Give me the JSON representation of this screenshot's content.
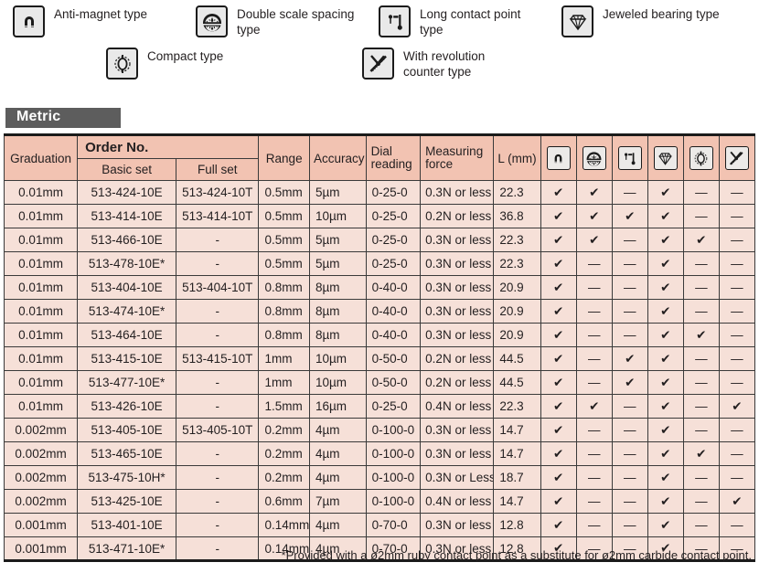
{
  "legend": {
    "row1": [
      {
        "icon": "anti-magnet-icon",
        "label": "Anti-magnet type"
      },
      {
        "icon": "double-scale-spacing-icon",
        "label": "Double scale spacing type"
      },
      {
        "icon": "long-contact-point-icon",
        "label": "Long contact point type"
      },
      {
        "icon": "jeweled-bearing-icon",
        "label": "Jeweled bearing type"
      }
    ],
    "row2": [
      {
        "icon": "compact-icon",
        "label": "Compact type"
      },
      {
        "icon": "revolution-counter-icon",
        "label": "With revolution counter type"
      }
    ]
  },
  "banner": {
    "label": "Metric"
  },
  "table": {
    "headers": {
      "graduation": "Graduation",
      "order_no": "Order No.",
      "basic_set": "Basic set",
      "full_set": "Full set",
      "range": "Range",
      "accuracy": "Accuracy",
      "dial_reading": "Dial reading",
      "measuring_force": "Measuring force",
      "length": "L (mm)",
      "icon_cols": [
        "anti-magnet-icon",
        "double-scale-spacing-icon",
        "long-contact-point-icon",
        "jeweled-bearing-icon",
        "compact-icon",
        "revolution-counter-icon"
      ]
    },
    "rows": [
      {
        "graduation": "0.01mm",
        "basic_set": "513-424-10E",
        "full_set": "513-424-10T",
        "range": "0.5mm",
        "accuracy": "5µm",
        "dial_reading": "0-25-0",
        "measuring_force": "0.3N or less",
        "length": "22.3",
        "marks": [
          "✔",
          "✔",
          "—",
          "✔",
          "—",
          "—"
        ]
      },
      {
        "graduation": "0.01mm",
        "basic_set": "513-414-10E",
        "full_set": "513-414-10T",
        "range": "0.5mm",
        "accuracy": "10µm",
        "dial_reading": "0-25-0",
        "measuring_force": "0.2N or less",
        "length": "36.8",
        "marks": [
          "✔",
          "✔",
          "✔",
          "✔",
          "—",
          "—"
        ]
      },
      {
        "graduation": "0.01mm",
        "basic_set": "513-466-10E",
        "full_set": "-",
        "range": "0.5mm",
        "accuracy": "5µm",
        "dial_reading": "0-25-0",
        "measuring_force": "0.3N or less",
        "length": "22.3",
        "marks": [
          "✔",
          "✔",
          "—",
          "✔",
          "✔",
          "—"
        ]
      },
      {
        "graduation": "0.01mm",
        "basic_set": "513-478-10E*",
        "full_set": "-",
        "range": "0.5mm",
        "accuracy": "5µm",
        "dial_reading": "0-25-0",
        "measuring_force": "0.3N or less",
        "length": "22.3",
        "marks": [
          "✔",
          "—",
          "—",
          "✔",
          "—",
          "—"
        ]
      },
      {
        "graduation": "0.01mm",
        "basic_set": "513-404-10E",
        "full_set": "513-404-10T",
        "range": "0.8mm",
        "accuracy": "8µm",
        "dial_reading": "0-40-0",
        "measuring_force": "0.3N or less",
        "length": "20.9",
        "marks": [
          "✔",
          "—",
          "—",
          "✔",
          "—",
          "—"
        ]
      },
      {
        "graduation": "0.01mm",
        "basic_set": "513-474-10E*",
        "full_set": "-",
        "range": "0.8mm",
        "accuracy": "8µm",
        "dial_reading": "0-40-0",
        "measuring_force": "0.3N or less",
        "length": "20.9",
        "marks": [
          "✔",
          "—",
          "—",
          "✔",
          "—",
          "—"
        ]
      },
      {
        "graduation": "0.01mm",
        "basic_set": "513-464-10E",
        "full_set": "-",
        "range": "0.8mm",
        "accuracy": "8µm",
        "dial_reading": "0-40-0",
        "measuring_force": "0.3N or less",
        "length": "20.9",
        "marks": [
          "✔",
          "—",
          "—",
          "✔",
          "✔",
          "—"
        ]
      },
      {
        "graduation": "0.01mm",
        "basic_set": "513-415-10E",
        "full_set": "513-415-10T",
        "range": "1mm",
        "accuracy": "10µm",
        "dial_reading": "0-50-0",
        "measuring_force": "0.2N or less",
        "length": "44.5",
        "marks": [
          "✔",
          "—",
          "✔",
          "✔",
          "—",
          "—"
        ]
      },
      {
        "graduation": "0.01mm",
        "basic_set": "513-477-10E*",
        "full_set": "-",
        "range": "1mm",
        "accuracy": "10µm",
        "dial_reading": "0-50-0",
        "measuring_force": "0.2N or less",
        "length": "44.5",
        "marks": [
          "✔",
          "—",
          "✔",
          "✔",
          "—",
          "—"
        ]
      },
      {
        "graduation": "0.01mm",
        "basic_set": "513-426-10E",
        "full_set": "-",
        "range": "1.5mm",
        "accuracy": "16µm",
        "dial_reading": "0-25-0",
        "measuring_force": "0.4N or less",
        "length": "22.3",
        "marks": [
          "✔",
          "✔",
          "—",
          "✔",
          "—",
          "✔"
        ]
      },
      {
        "graduation": "0.002mm",
        "basic_set": "513-405-10E",
        "full_set": "513-405-10T",
        "range": "0.2mm",
        "accuracy": "4µm",
        "dial_reading": "0-100-0",
        "measuring_force": "0.3N or less",
        "length": "14.7",
        "marks": [
          "✔",
          "—",
          "—",
          "✔",
          "—",
          "—"
        ]
      },
      {
        "graduation": "0.002mm",
        "basic_set": "513-465-10E",
        "full_set": "-",
        "range": "0.2mm",
        "accuracy": "4µm",
        "dial_reading": "0-100-0",
        "measuring_force": "0.3N or less",
        "length": "14.7",
        "marks": [
          "✔",
          "—",
          "—",
          "✔",
          "✔",
          "—"
        ]
      },
      {
        "graduation": "0.002mm",
        "basic_set": "513-475-10H*",
        "full_set": "-",
        "range": "0.2mm",
        "accuracy": "4µm",
        "dial_reading": "0-100-0",
        "measuring_force": "0.3N or Less",
        "length": "18.7",
        "marks": [
          "✔",
          "—",
          "—",
          "✔",
          "—",
          "—"
        ]
      },
      {
        "graduation": "0.002mm",
        "basic_set": "513-425-10E",
        "full_set": "-",
        "range": "0.6mm",
        "accuracy": "7µm",
        "dial_reading": "0-100-0",
        "measuring_force": "0.4N or less",
        "length": "14.7",
        "marks": [
          "✔",
          "—",
          "—",
          "✔",
          "—",
          "✔"
        ]
      },
      {
        "graduation": "0.001mm",
        "basic_set": "513-401-10E",
        "full_set": "-",
        "range": "0.14mm",
        "accuracy": "4µm",
        "dial_reading": "0-70-0",
        "measuring_force": "0.3N or less",
        "length": "12.8",
        "marks": [
          "✔",
          "—",
          "—",
          "✔",
          "—",
          "—"
        ]
      },
      {
        "graduation": "0.001mm",
        "basic_set": "513-471-10E*",
        "full_set": "-",
        "range": "0.14mm",
        "accuracy": "4µm",
        "dial_reading": "0-70-0",
        "measuring_force": "0.3N or less",
        "length": "12.8",
        "marks": [
          "✔",
          "—",
          "—",
          "✔",
          "—",
          "—"
        ]
      }
    ]
  },
  "footnote": "*Provided with a ø2mm ruby contact point as a substitute for ø2mm carbide contact point.",
  "colors": {
    "header_bg": "#f2c3b2",
    "row_bg": "#f6e0d8",
    "banner_bg": "#5d5d5d",
    "border": "#3a3a3a",
    "text": "#231f20"
  }
}
